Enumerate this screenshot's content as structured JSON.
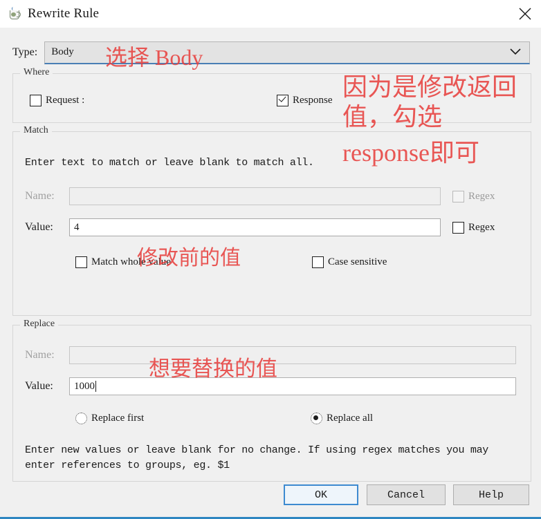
{
  "window": {
    "title": "Rewrite Rule",
    "app_icon": "java-cup-icon",
    "close_icon": "close-icon"
  },
  "type_row": {
    "label": "Type:",
    "selected": "Body",
    "dropdown_icon": "chevron-down-icon"
  },
  "where": {
    "title": "Where",
    "request": {
      "label": "Request :",
      "checked": false
    },
    "response": {
      "label": "Response",
      "checked": true
    }
  },
  "match": {
    "title": "Match",
    "hint": "Enter text to match or leave blank to match all.",
    "name_label": "Name:",
    "name_value": "",
    "name_enabled": false,
    "name_regex": {
      "label": "Regex",
      "checked": false,
      "enabled": false
    },
    "value_label": "Value:",
    "value_value": "4",
    "value_regex": {
      "label": "Regex",
      "checked": false,
      "enabled": true
    },
    "match_whole": {
      "label": "Match whole value",
      "checked": false
    },
    "case_sensitive": {
      "label": "Case sensitive",
      "checked": false
    }
  },
  "replace": {
    "title": "Replace",
    "name_label": "Name:",
    "name_value": "",
    "name_enabled": false,
    "value_label": "Value:",
    "value_value": "1000",
    "replace_first": {
      "label": "Replace first",
      "selected": false
    },
    "replace_all": {
      "label": "Replace all",
      "selected": true
    },
    "hint_line1": "Enter new values or leave blank for no change. If using regex matches you may",
    "hint_line2": "enter references to groups, eg. $1"
  },
  "buttons": {
    "ok": "OK",
    "cancel": "Cancel",
    "help": "Help"
  },
  "annotations": {
    "type": "选择 Body",
    "where_line1": "因为是修改返回",
    "where_line2": "值，勾选",
    "where_line3": "response即可",
    "match_value": "修改前的值",
    "replace_value": "想要替换的值"
  },
  "colors": {
    "accent": "#2e86c1",
    "annotation": "#e8413f",
    "dialog_bg": "#f0f0f0",
    "default_button_border": "#3d8ad0"
  }
}
